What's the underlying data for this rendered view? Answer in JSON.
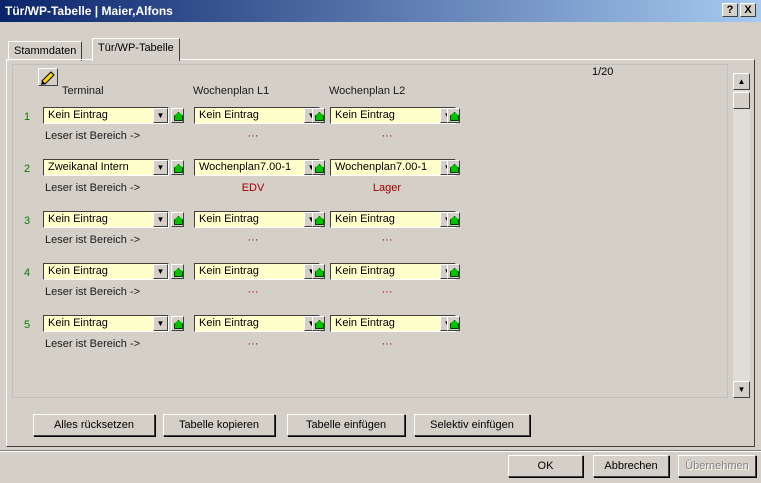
{
  "window": {
    "title": "Tür/WP-Tabelle | Maier,Alfons",
    "help_glyph": "?",
    "close_glyph": "X"
  },
  "tabs": [
    "Stammdaten",
    "Tür/WP-Tabelle"
  ],
  "pager": "1/20",
  "columns": {
    "terminal": "Terminal",
    "wp1": "Wochenplan L1",
    "wp2": "Wochenplan L2"
  },
  "rows": [
    {
      "num": "1",
      "terminal": "Kein Eintrag",
      "wp1": "Kein Eintrag",
      "wp2": "Kein Eintrag",
      "leser": "Leser ist Bereich ->",
      "area1": "···",
      "area2": "···"
    },
    {
      "num": "2",
      "terminal": "Zweikanal Intern",
      "wp1": "Wochenplan7.00-1",
      "wp2": "Wochenplan7.00-1",
      "leser": "Leser ist Bereich ->",
      "area1": "EDV",
      "area2": "Lager"
    },
    {
      "num": "3",
      "terminal": "Kein Eintrag",
      "wp1": "Kein Eintrag",
      "wp2": "Kein Eintrag",
      "leser": "Leser ist Bereich ->",
      "area1": "···",
      "area2": "···"
    },
    {
      "num": "4",
      "terminal": "Kein Eintrag",
      "wp1": "Kein Eintrag",
      "wp2": "Kein Eintrag",
      "leser": "Leser ist Bereich ->",
      "area1": "···",
      "area2": "···"
    },
    {
      "num": "5",
      "terminal": "Kein Eintrag",
      "wp1": "Kein Eintrag",
      "wp2": "Kein Eintrag",
      "leser": "Leser ist Bereich ->",
      "area1": "···",
      "area2": "···"
    }
  ],
  "actions": {
    "reset": "Alles rücksetzen",
    "copy": "Tabelle kopieren",
    "paste": "Tabelle einfügen",
    "selective": "Selektiv einfügen"
  },
  "footer": {
    "ok": "OK",
    "cancel": "Abbrechen",
    "apply": "Übernehmen"
  },
  "icons": {
    "dropdown": "dropdown-arrow-icon",
    "goto": "green-house-icon",
    "pencil": "pencil-icon"
  },
  "colors": {
    "title_start": "#0a246a",
    "combo_bg": "#ffffcc",
    "rownum": "#008000",
    "area_text": "#a00000"
  }
}
